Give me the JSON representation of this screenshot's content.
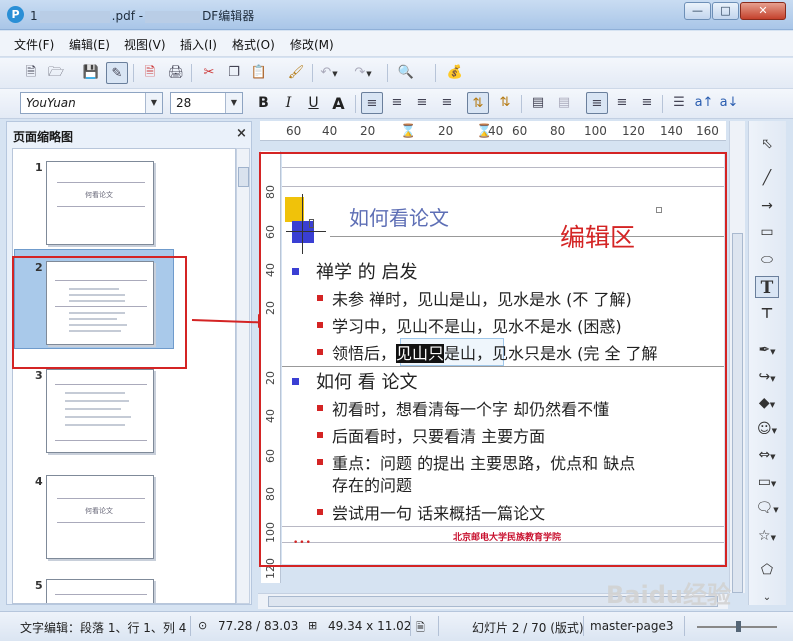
{
  "window": {
    "title_prefix": "1",
    "title_mid": ".pdf -",
    "title_suffix": "DF编辑器"
  },
  "menu": [
    "文件(F)",
    "编辑(E)",
    "视图(V)",
    "插入(I)",
    "格式(O)",
    "修改(M)"
  ],
  "format_bar": {
    "font_name": "YouYuan",
    "font_size": "28",
    "bold": "B",
    "italic": "I",
    "underline": "U",
    "shadow": "A"
  },
  "left_panel": {
    "title": "页面缩略图",
    "close": "×",
    "thumbnails": [
      {
        "num": "1",
        "title": "何看论文"
      },
      {
        "num": "2",
        "title": ""
      },
      {
        "num": "3",
        "title": ""
      },
      {
        "num": "4",
        "title": "何看论文"
      },
      {
        "num": "5",
        "title": ""
      }
    ]
  },
  "ruler": {
    "h_labels": [
      "60",
      "40",
      "20",
      "20",
      "40",
      "60",
      "80",
      "100",
      "120",
      "140",
      "160"
    ],
    "v_labels": [
      "80",
      "60",
      "40",
      "20",
      "20",
      "40",
      "60",
      "80",
      "100",
      "120"
    ]
  },
  "slide": {
    "title": "如何看论文",
    "edit_label": "编辑区",
    "section1": "禅学 的 启发",
    "items1": [
      "未参 禅时，见山是山，见水是水 (不 了解)",
      "学习中，见山不是山，见水不是水 (困惑)"
    ],
    "item1_3_pre": "领悟后，",
    "item1_3_sel": "见山只",
    "item1_3_post": "是山，见水只是水 (完 全 了解",
    "section2": "如何 看 论文",
    "items2": [
      "初看时，想看清每一个字  却仍然看不懂",
      "后面看时，只要看清 主要方面",
      "重点：问题 的提出  主要思路，优点和 缺点",
      "存在的问题",
      "尝试用一句 话来概括一篇论文"
    ],
    "footer": "北京邮电大学民族教育学院",
    "dots": "•••"
  },
  "status": {
    "mode": "文字编辑：段落 1、行 1、列 4",
    "position": "77.28 / 83.03",
    "size": "49.34 x 11.02",
    "slide_info": "幻灯片 2 / 70 (版式)",
    "master": "master-page3"
  },
  "watermark": "Baidu经验"
}
